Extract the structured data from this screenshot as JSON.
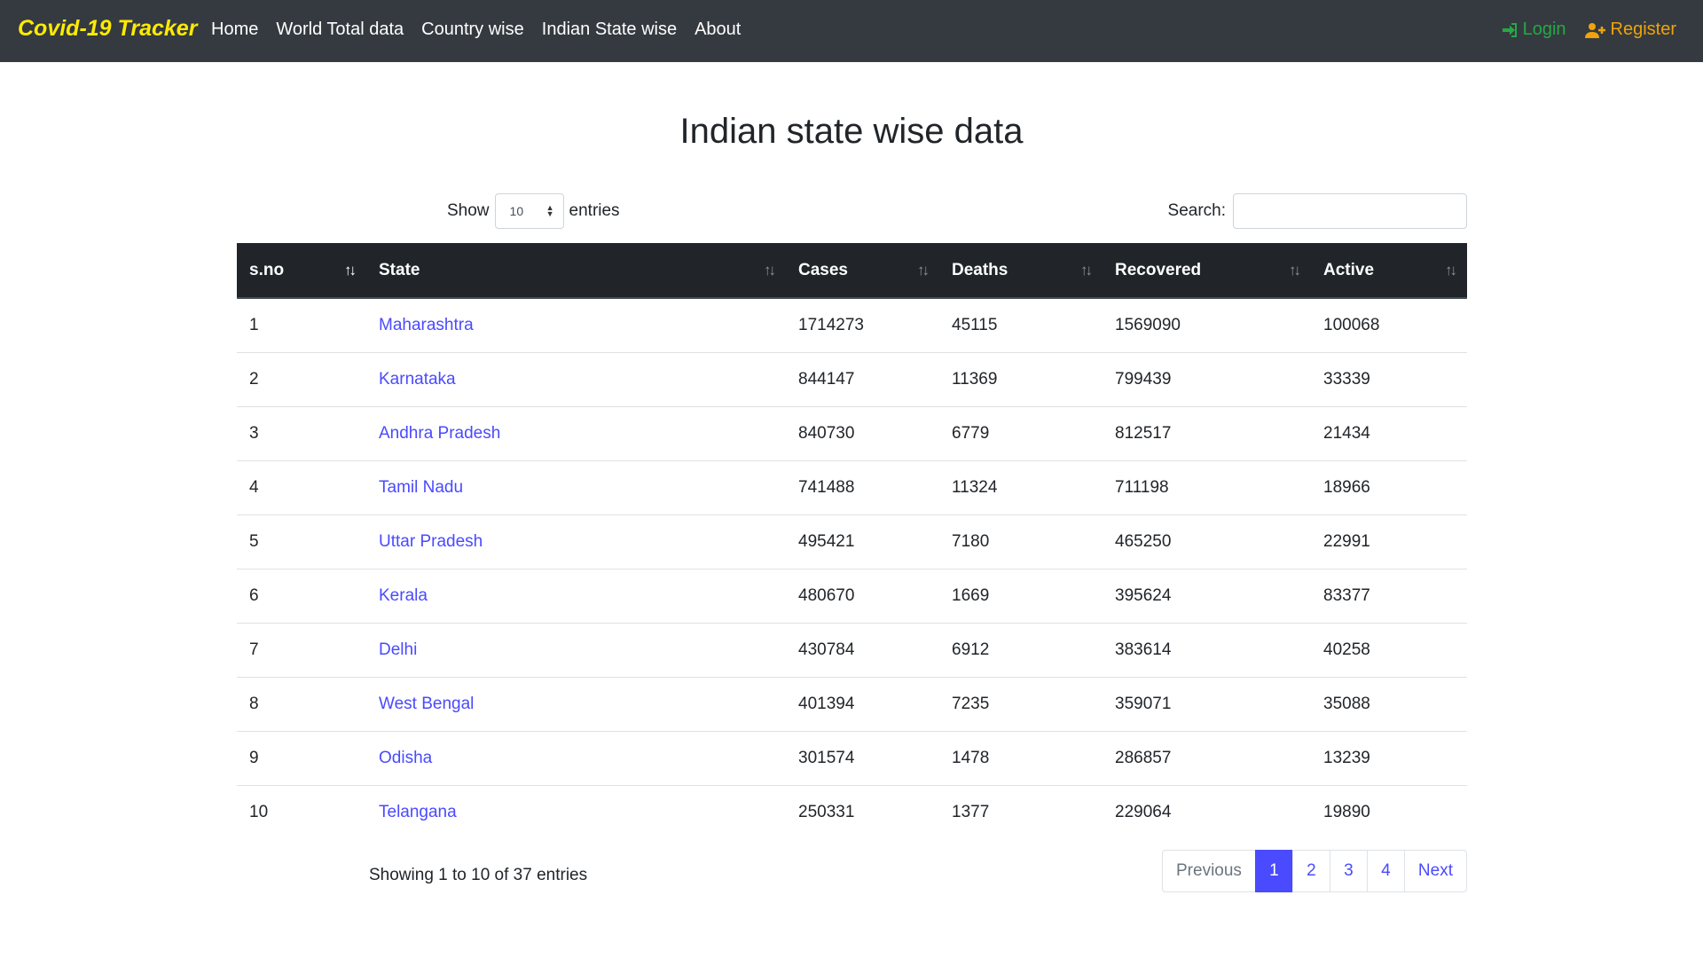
{
  "navbar": {
    "brand": "Covid-19 Tracker",
    "links": [
      "Home",
      "World Total data",
      "Country wise",
      "Indian State wise",
      "About"
    ],
    "login_label": "Login",
    "register_label": "Register",
    "login_icon": "sign-in-icon",
    "register_icon": "user-plus-icon",
    "colors": {
      "brand": "#ffeb00",
      "login": "#28a745",
      "register": "#f0a30a",
      "background": "#343a40"
    }
  },
  "page": {
    "title": "Indian state wise data"
  },
  "controls": {
    "show_label": "Show",
    "entries_value": "10",
    "entries_label": "entries",
    "search_label": "Search:",
    "search_value": ""
  },
  "table": {
    "headers": [
      "s.no",
      "State",
      "Cases",
      "Deaths",
      "Recovered",
      "Active"
    ],
    "rows": [
      [
        "1",
        "Maharashtra",
        "1714273",
        "45115",
        "1569090",
        "100068"
      ],
      [
        "2",
        "Karnataka",
        "844147",
        "11369",
        "799439",
        "33339"
      ],
      [
        "3",
        "Andhra Pradesh",
        "840730",
        "6779",
        "812517",
        "21434"
      ],
      [
        "4",
        "Tamil Nadu",
        "741488",
        "11324",
        "711198",
        "18966"
      ],
      [
        "5",
        "Uttar Pradesh",
        "495421",
        "7180",
        "465250",
        "22991"
      ],
      [
        "6",
        "Kerala",
        "480670",
        "1669",
        "395624",
        "83377"
      ],
      [
        "7",
        "Delhi",
        "430784",
        "6912",
        "383614",
        "40258"
      ],
      [
        "8",
        "West Bengal",
        "401394",
        "7235",
        "359071",
        "35088"
      ],
      [
        "9",
        "Odisha",
        "301574",
        "1478",
        "286857",
        "13239"
      ],
      [
        "10",
        "Telangana",
        "250331",
        "1377",
        "229064",
        "19890"
      ]
    ]
  },
  "footer": {
    "info": "Showing 1 to 10 of 37 entries",
    "pagination": {
      "previous": "Previous",
      "pages": [
        "1",
        "2",
        "3",
        "4"
      ],
      "active_page": "1",
      "next": "Next"
    }
  },
  "colors": {
    "link": "#4a4aff",
    "table_header": "#212529"
  }
}
